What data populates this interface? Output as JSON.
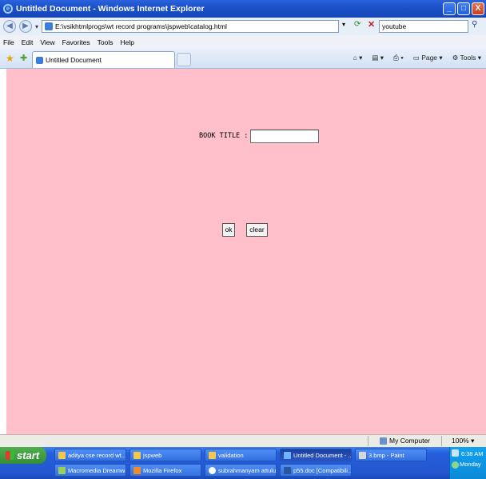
{
  "window": {
    "title": "Untitled Document - Windows Internet Explorer",
    "buttons": [
      "_",
      "□",
      "X"
    ]
  },
  "address_bar": {
    "url": "E:\\vsikhtmlprogs\\wt record programs\\jspweb\\catalog.html",
    "search_value": "youtube"
  },
  "menu": [
    "File",
    "Edit",
    "View",
    "Favorites",
    "Tools",
    "Help"
  ],
  "tabs": [
    {
      "label": "Untitled Document"
    }
  ],
  "command_bar": {
    "page": "Page",
    "tools": "Tools"
  },
  "form": {
    "book_title_label": "BOOK TITLE :",
    "book_title_value": "",
    "ok_label": "ok",
    "clear_label": "clear"
  },
  "status_bar": {
    "zone": "My Computer",
    "zoom": "100%"
  },
  "taskbar": {
    "start_label": "start",
    "tasks_row1": [
      {
        "label": "aditya cse record wt..."
      },
      {
        "label": "jspweb"
      },
      {
        "label": "validation"
      },
      {
        "label": "Untitled Document - ...",
        "active": true
      },
      {
        "label": "3.bmp - Paint"
      }
    ],
    "tasks_row2": [
      {
        "label": "Macromedia Dreamw..."
      },
      {
        "label": "Mozilla Firefox"
      },
      {
        "label": "subrahmanyam attuluri"
      },
      {
        "label": "p55.doc [Compatibili..."
      }
    ],
    "clock": "6:38 AM",
    "day": "Monday"
  },
  "colors": {
    "content_background": "#ffbfcb",
    "title_bar": "#1a4fc8"
  }
}
